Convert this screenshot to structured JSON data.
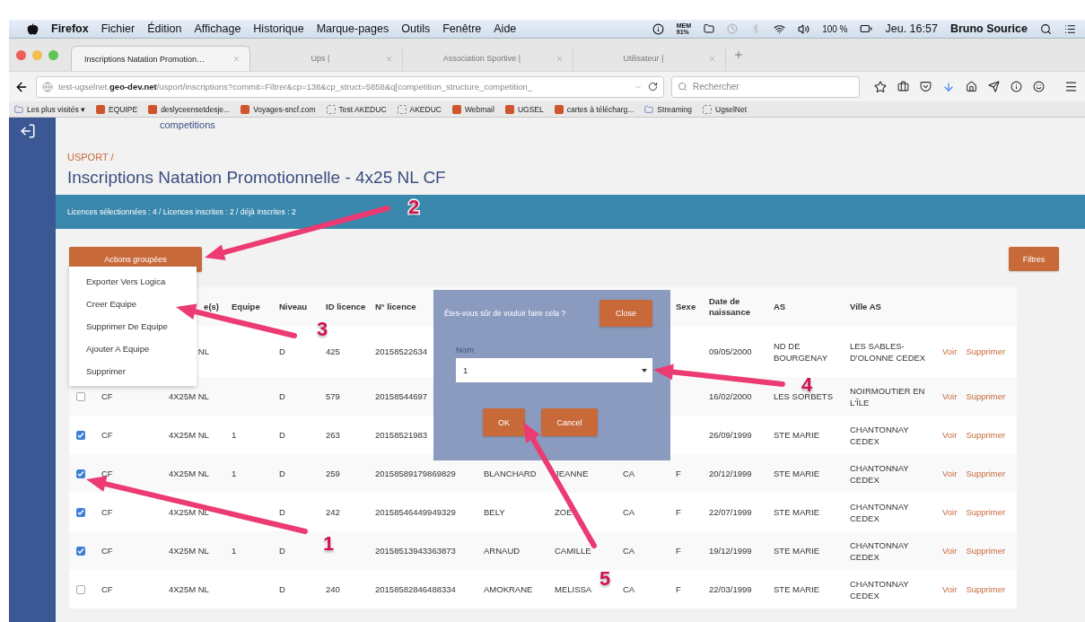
{
  "menu_bar": {
    "app": "Firefox",
    "items": [
      "Fichier",
      "Édition",
      "Affichage",
      "Historique",
      "Marque-pages",
      "Outils",
      "Fenêtre",
      "Aide"
    ],
    "memory": {
      "label": "MEM",
      "value": "91%"
    },
    "battery": "100 %",
    "clock": "Jeu. 16:57",
    "user": "Bruno Sourice"
  },
  "tabs": [
    {
      "label": "Inscriptions Natation Promotion…",
      "selected": true
    },
    {
      "label": "Ups |",
      "selected": false
    },
    {
      "label": "Association Sportive |",
      "selected": false
    },
    {
      "label": "Utilisateur |",
      "selected": false
    }
  ],
  "address_bar": {
    "url": "test-ugselnet.**geo-dev.net**/usport/inscriptions?commit=Filtrer&cp=138&cp_struct=5858&q[competition_structure_competition_"
  },
  "search": {
    "placeholder": "Rechercher"
  },
  "bookmarks": [
    {
      "label": "Les plus visités ▾",
      "kind": "folder"
    },
    {
      "label": "EQUIPE",
      "kind": "site"
    },
    {
      "label": "deslyceensetdesje...",
      "kind": "site"
    },
    {
      "label": "Voyages-sncf.com",
      "kind": "site"
    },
    {
      "label": "Test AKEDUC",
      "kind": "page"
    },
    {
      "label": "AKEDUC",
      "kind": "page"
    },
    {
      "label": "Webmail",
      "kind": "site"
    },
    {
      "label": "UGSEL",
      "kind": "site"
    },
    {
      "label": "cartes à télécharg...",
      "kind": "site"
    },
    {
      "label": "Streaming",
      "kind": "folder"
    },
    {
      "label": "UgselNet",
      "kind": "page"
    }
  ],
  "page": {
    "top_link": "competitions",
    "breadcrumb": "USPORT /",
    "title": "Inscriptions Natation Promotionnelle - 4x25 NL CF",
    "summary": "Licences sélectionnées : 4 / Licences inscrites : 2 / déjà Inscrites : 2",
    "actions_button": "Actions groupées",
    "filters_button": "Filtres"
  },
  "actions_menu": [
    "Exporter Vers Logica",
    "Creer Equipe",
    "Supprimer De Equipe",
    "Ajouter A Equipe",
    "Supprimer"
  ],
  "table": {
    "columns": [
      null,
      "e(s)",
      "Equipe",
      "Niveau",
      "ID licence",
      "N° licence",
      null,
      null,
      null,
      "Sexe",
      "Date de naissance",
      "AS",
      "Ville AS",
      null
    ],
    "rows": [
      {
        "cells": [
          null,
          "NL",
          null,
          "D",
          "425",
          "20158522634",
          null,
          null,
          null,
          null,
          "09/05/2000",
          "ND DE BOURGENAY",
          "LES SABLES-D'OLONNE CEDEX"
        ],
        "actions": [
          "Voir",
          "Supprimer"
        ]
      },
      {
        "checked": false,
        "cells": [
          "CF",
          "4X25M NL",
          null,
          "D",
          "579",
          "20158544697",
          null,
          null,
          null,
          null,
          "16/02/2000",
          "LES SORBETS",
          "NOIRMOUTIER EN L'ÎLE"
        ],
        "actions": [
          "Voir",
          "Supprimer"
        ]
      },
      {
        "checked": true,
        "cells": [
          "CF",
          "4X25M NL",
          "1",
          "D",
          "263",
          "20158521983",
          null,
          null,
          null,
          null,
          "26/09/1999",
          "STE MARIE",
          "CHANTONNAY CEDEX"
        ],
        "actions": [
          "Voir",
          "Supprimer"
        ]
      },
      {
        "checked": true,
        "cells": [
          "CF",
          "4X25M NL",
          "1",
          "D",
          "259",
          "20158589179869829",
          "BLANCHARD",
          "JEANNE",
          "CA",
          "F",
          "20/12/1999",
          "STE MARIE",
          "CHANTONNAY CEDEX"
        ],
        "actions": [
          "Voir",
          "Supprimer"
        ]
      },
      {
        "checked": true,
        "cells": [
          "CF",
          "4X25M NL",
          null,
          "D",
          "242",
          "20158546449949329",
          "BELY",
          "ZOE",
          "CA",
          "F",
          "22/07/1999",
          "STE MARIE",
          "CHANTONNAY CEDEX"
        ],
        "actions": [
          "Voir",
          "Supprimer"
        ]
      },
      {
        "checked": true,
        "cells": [
          "CF",
          "4X25M NL",
          "1",
          "D",
          null,
          "20158513943363873",
          "ARNAUD",
          "CAMILLE",
          "CA",
          "F",
          "19/12/1999",
          "STE MARIE",
          "CHANTONNAY CEDEX"
        ],
        "actions": [
          "Voir",
          "Supprimer"
        ]
      },
      {
        "checked": false,
        "cells": [
          "CF",
          "4X25M NL",
          null,
          "D",
          "240",
          "20158582846488334",
          "AMOKRANE",
          "MELISSA",
          "CA",
          "F",
          "22/03/1999",
          "STE MARIE",
          "CHANTONNAY CEDEX"
        ],
        "actions": [
          "Voir",
          "Supprimer"
        ]
      }
    ]
  },
  "dialog": {
    "message": "Êtes-vous sûr de vouloir faire cela ?",
    "close": "Close",
    "field_label": "Nom",
    "field_value": "1",
    "ok": "OK",
    "cancel": "Cancel"
  },
  "annotations": [
    {
      "label": "1"
    },
    {
      "label": "2"
    },
    {
      "label": "3"
    },
    {
      "label": "4"
    },
    {
      "label": "5"
    }
  ]
}
